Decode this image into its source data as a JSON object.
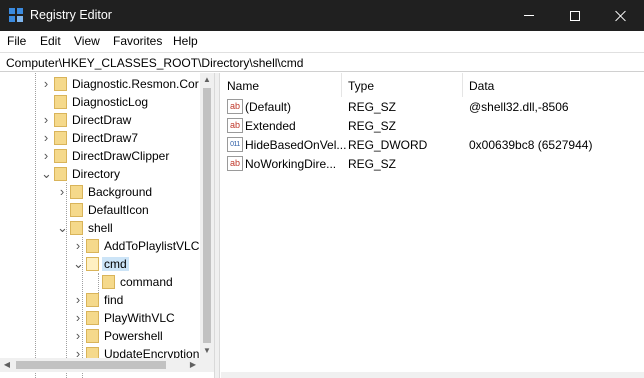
{
  "window": {
    "title": "Registry Editor",
    "controls": {
      "minimize": "minimize",
      "maximize": "maximize",
      "close": "close"
    }
  },
  "menu": [
    "File",
    "Edit",
    "View",
    "Favorites",
    "Help"
  ],
  "address": "Computer\\HKEY_CLASSES_ROOT\\Directory\\shell\\cmd",
  "tree": {
    "items": [
      {
        "label": "Diagnostic.Resmon.Cor",
        "expander": "collapsed"
      },
      {
        "label": "DiagnosticLog",
        "expander": "none"
      },
      {
        "label": "DirectDraw",
        "expander": "collapsed"
      },
      {
        "label": "DirectDraw7",
        "expander": "collapsed"
      },
      {
        "label": "DirectDrawClipper",
        "expander": "collapsed"
      },
      {
        "label": "Directory",
        "expander": "expanded"
      },
      {
        "label": "Background",
        "expander": "collapsed"
      },
      {
        "label": "DefaultIcon",
        "expander": "none"
      },
      {
        "label": "shell",
        "expander": "expanded"
      },
      {
        "label": "AddToPlaylistVLC",
        "expander": "collapsed"
      },
      {
        "label": "cmd",
        "expander": "expanded",
        "selected": true
      },
      {
        "label": "command",
        "expander": "none"
      },
      {
        "label": "find",
        "expander": "collapsed"
      },
      {
        "label": "PlayWithVLC",
        "expander": "collapsed"
      },
      {
        "label": "Powershell",
        "expander": "collapsed"
      },
      {
        "label": "UpdateEncryption",
        "expander": "collapsed"
      }
    ]
  },
  "values": {
    "columns": {
      "name": "Name",
      "type": "Type",
      "data": "Data"
    },
    "rows": [
      {
        "name": "(Default)",
        "type": "REG_SZ",
        "data": "@shell32.dll,-8506",
        "icon": "string-value-icon"
      },
      {
        "name": "Extended",
        "type": "REG_SZ",
        "data": "",
        "icon": "string-value-icon"
      },
      {
        "name": "HideBasedOnVel...",
        "type": "REG_DWORD",
        "data": "0x00639bc8 (6527944)",
        "icon": "dword-value-icon"
      },
      {
        "name": "NoWorkingDire...",
        "type": "REG_SZ",
        "data": "",
        "icon": "string-value-icon"
      }
    ]
  },
  "icons": {
    "string": "ab",
    "dword": "011"
  },
  "colors": {
    "titlebar": "#202020",
    "selection": "#cce4f7",
    "folder": "#f5d98b"
  }
}
